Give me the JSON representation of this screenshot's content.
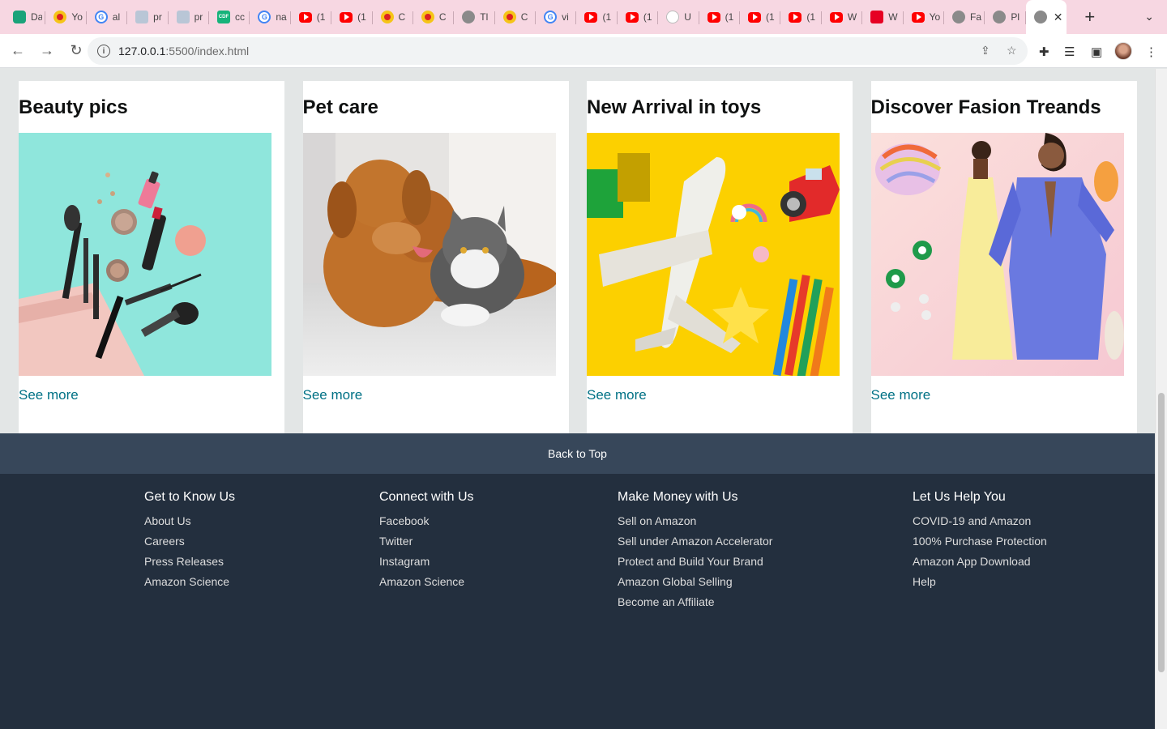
{
  "browser": {
    "tabs": [
      {
        "icon": "shield-icon",
        "title": "Da"
      },
      {
        "icon": "codeacademy-icon",
        "title": "Yo"
      },
      {
        "icon": "google-icon",
        "title": "al"
      },
      {
        "icon": "image-icon",
        "title": "pr"
      },
      {
        "icon": "image-icon",
        "title": "pr"
      },
      {
        "icon": "cdf-icon",
        "title": "cc"
      },
      {
        "icon": "google-icon",
        "title": "na"
      },
      {
        "icon": "youtube-icon",
        "title": "(1"
      },
      {
        "icon": "youtube-icon",
        "title": "(1"
      },
      {
        "icon": "codeacademy-icon",
        "title": "C"
      },
      {
        "icon": "codeacademy-icon",
        "title": "C"
      },
      {
        "icon": "globe-icon",
        "title": "Tl"
      },
      {
        "icon": "codeacademy-icon",
        "title": "C"
      },
      {
        "icon": "google-icon",
        "title": "vi"
      },
      {
        "icon": "youtube-icon",
        "title": "(1"
      },
      {
        "icon": "youtube-icon",
        "title": "(1"
      },
      {
        "icon": "github-icon",
        "title": "U"
      },
      {
        "icon": "youtube-icon",
        "title": "(1"
      },
      {
        "icon": "youtube-icon",
        "title": "(1"
      },
      {
        "icon": "youtube-icon",
        "title": "(1"
      },
      {
        "icon": "youtube-icon",
        "title": "W"
      },
      {
        "icon": "pinterest-icon",
        "title": "W"
      },
      {
        "icon": "youtube-icon",
        "title": "Yo"
      },
      {
        "icon": "globe-icon",
        "title": "Fa"
      },
      {
        "icon": "globe-icon",
        "title": "Pl"
      }
    ],
    "url_host": "127.0.0.1",
    "url_rest": ":5500/index.html"
  },
  "cards": [
    {
      "title": "Beauty pics",
      "link": "See more"
    },
    {
      "title": "Pet care",
      "link": "See more"
    },
    {
      "title": "New Arrival in toys",
      "link": "See more"
    },
    {
      "title": "Discover Fasion Treands",
      "link": "See more"
    }
  ],
  "back_to_top": "Back to Top",
  "footer": {
    "columns": [
      {
        "heading": "Get to Know Us",
        "links": [
          "About Us",
          "Careers",
          "Press Releases",
          "Amazon Science"
        ]
      },
      {
        "heading": "Connect with Us",
        "links": [
          "Facebook",
          "Twitter",
          "Instagram",
          "Amazon Science"
        ]
      },
      {
        "heading": "Make Money with Us",
        "links": [
          "Sell on Amazon",
          "Sell under Amazon Accelerator",
          "Protect and Build Your Brand",
          "Amazon Global Selling",
          "Become an Affiliate"
        ]
      },
      {
        "heading": "Let Us Help You",
        "links": [
          "COVID-19 and Amazon",
          "100% Purchase Protection",
          "Amazon App Download",
          "Help"
        ]
      }
    ]
  },
  "colors": {
    "link": "#007185",
    "footer_bg": "#232f3e",
    "backtop_bg": "#37475a",
    "tabstrip_bg": "#f7d7e2"
  }
}
